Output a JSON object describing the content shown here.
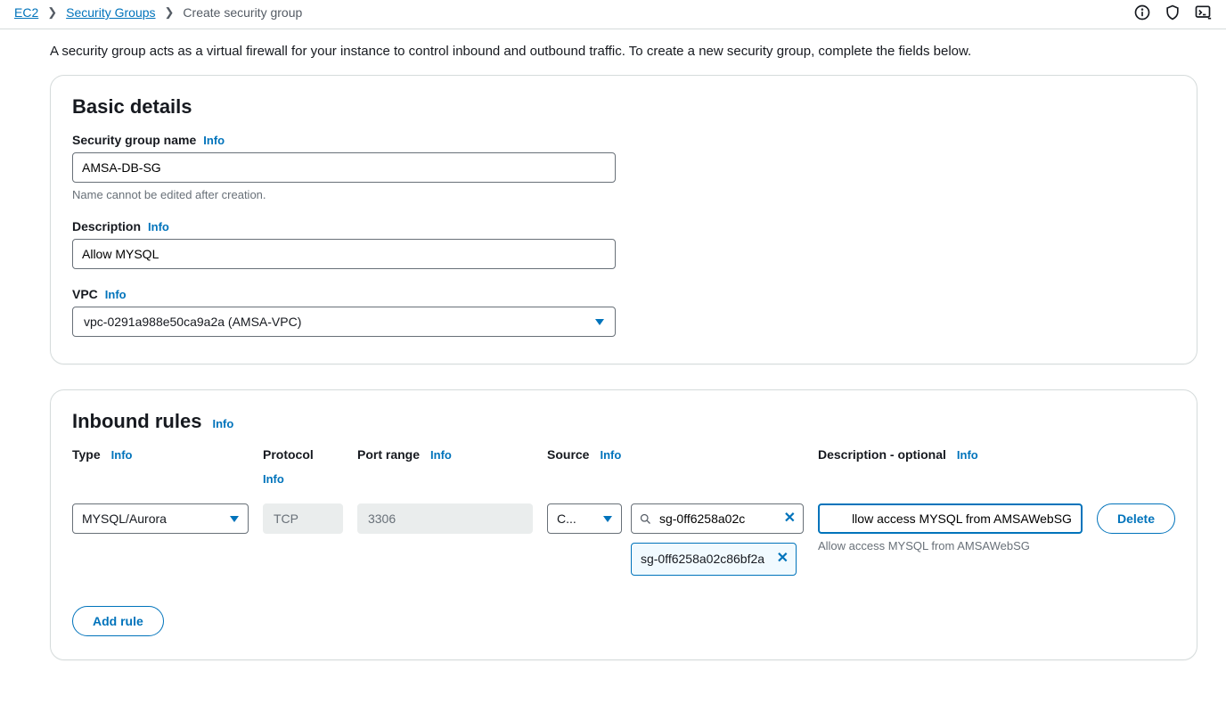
{
  "breadcrumb": {
    "items": [
      "EC2",
      "Security Groups"
    ],
    "current": "Create security group"
  },
  "intro": "A security group acts as a virtual firewall for your instance to control inbound and outbound traffic. To create a new security group, complete the fields below.",
  "info_label": "Info",
  "basic": {
    "title": "Basic details",
    "name_label": "Security group name",
    "name_value": "AMSA-DB-SG",
    "name_helper": "Name cannot be edited after creation.",
    "desc_label": "Description",
    "desc_value": "Allow MYSQL",
    "vpc_label": "VPC",
    "vpc_value": "vpc-0291a988e50ca9a2a (AMSA-VPC)"
  },
  "inbound": {
    "title": "Inbound rules",
    "headers": {
      "type": "Type",
      "protocol": "Protocol",
      "port_range": "Port range",
      "source": "Source",
      "description": "Description - optional"
    },
    "row": {
      "type": "MYSQL/Aurora",
      "protocol": "TCP",
      "port": "3306",
      "source_select": "C...",
      "source_search": "sg-0ff6258a02c",
      "source_tag": "sg-0ff6258a02c86bf2a",
      "desc_value": "Allow access MYSQL from AMSAWebSG",
      "desc_display": "llow access MYSQL from AMSAWebSG",
      "delete": "Delete"
    },
    "add_rule": "Add rule"
  }
}
